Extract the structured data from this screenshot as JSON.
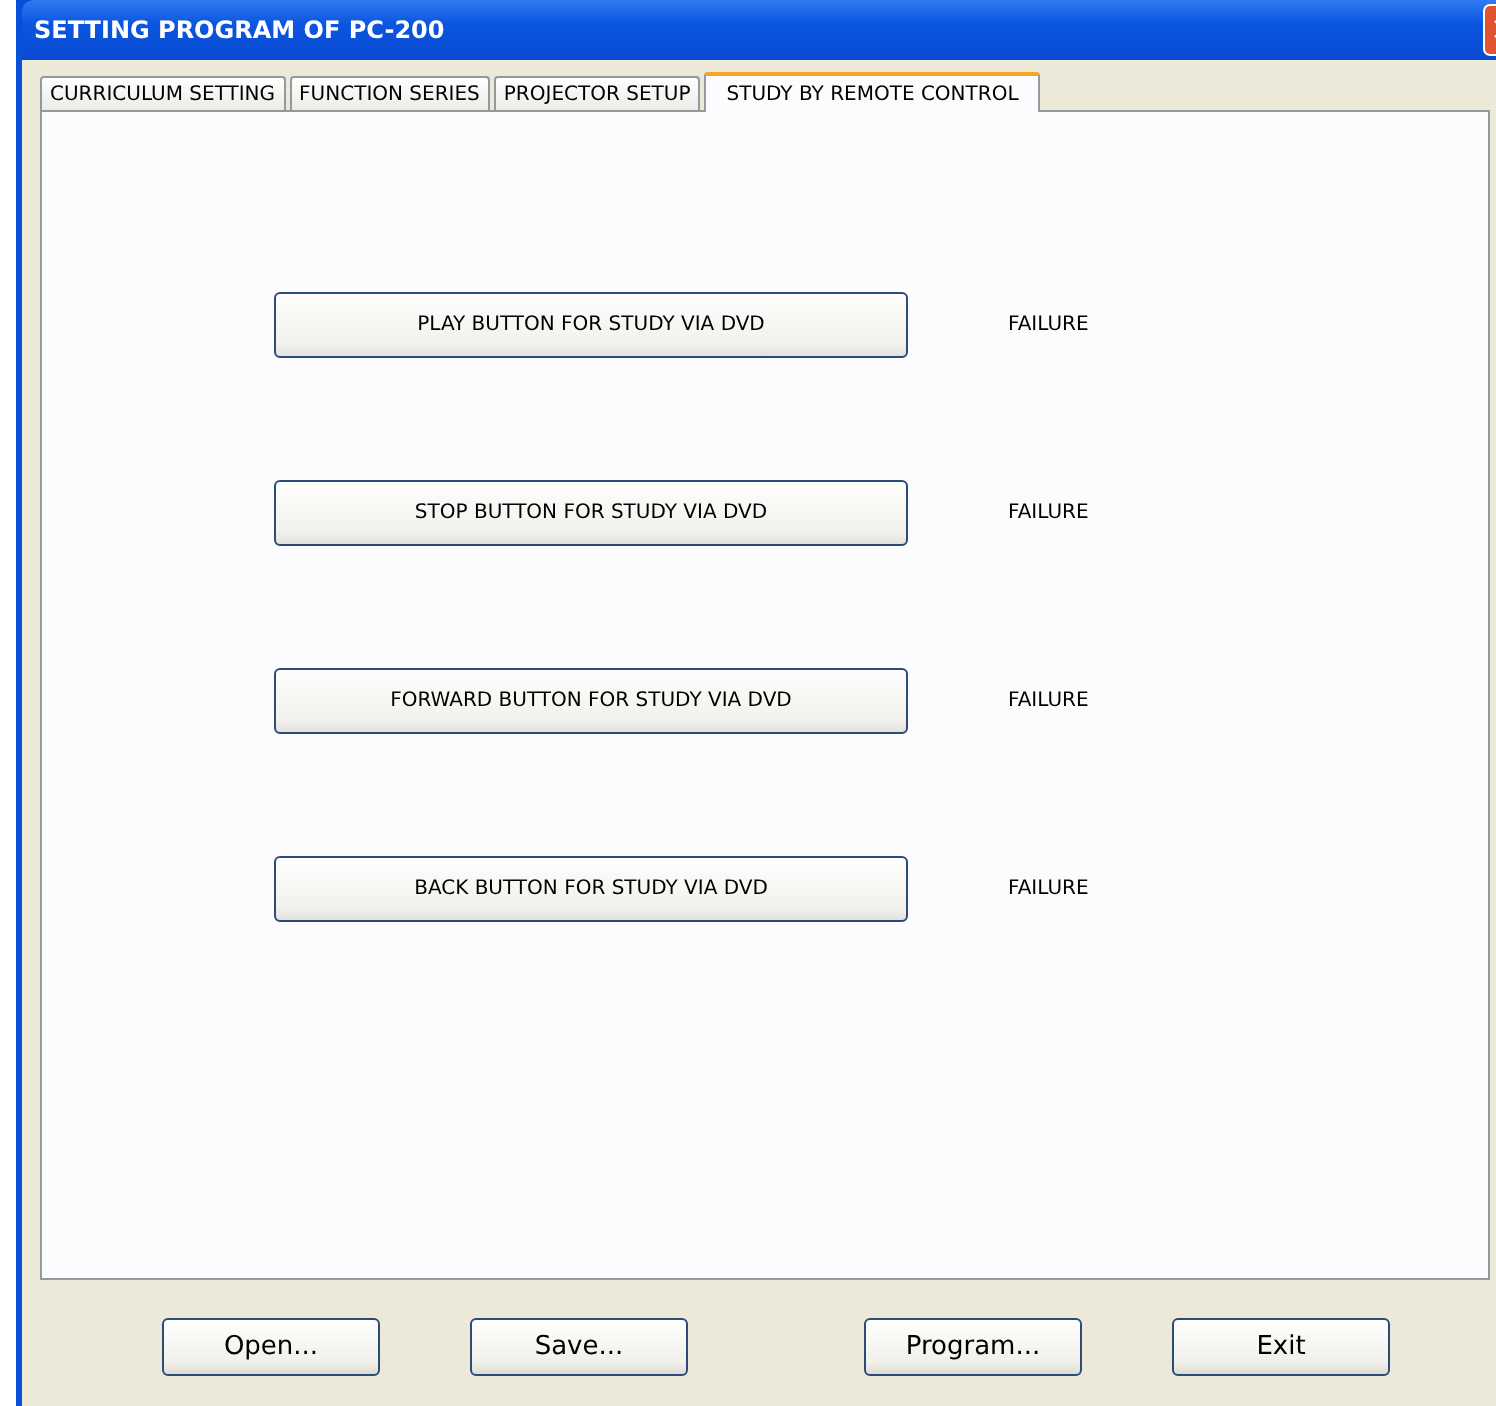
{
  "window": {
    "title": "SETTING PROGRAM OF PC-200"
  },
  "tabs": [
    {
      "label": "CURRICULUM SETTING",
      "selected": false
    },
    {
      "label": "FUNCTION SERIES",
      "selected": false
    },
    {
      "label": "PROJECTOR SETUP",
      "selected": false
    },
    {
      "label": "STUDY BY REMOTE CONTROL",
      "selected": true
    }
  ],
  "tests": [
    {
      "button": "PLAY BUTTON FOR STUDY VIA DVD",
      "status": "FAILURE"
    },
    {
      "button": "STOP BUTTON FOR STUDY VIA DVD",
      "status": "FAILURE"
    },
    {
      "button": "FORWARD BUTTON FOR STUDY VIA DVD",
      "status": "FAILURE"
    },
    {
      "button": "BACK BUTTON FOR STUDY VIA DVD",
      "status": "FAILURE"
    }
  ],
  "buttons": [
    "Open...",
    "Save...",
    "Program...",
    "Exit"
  ]
}
